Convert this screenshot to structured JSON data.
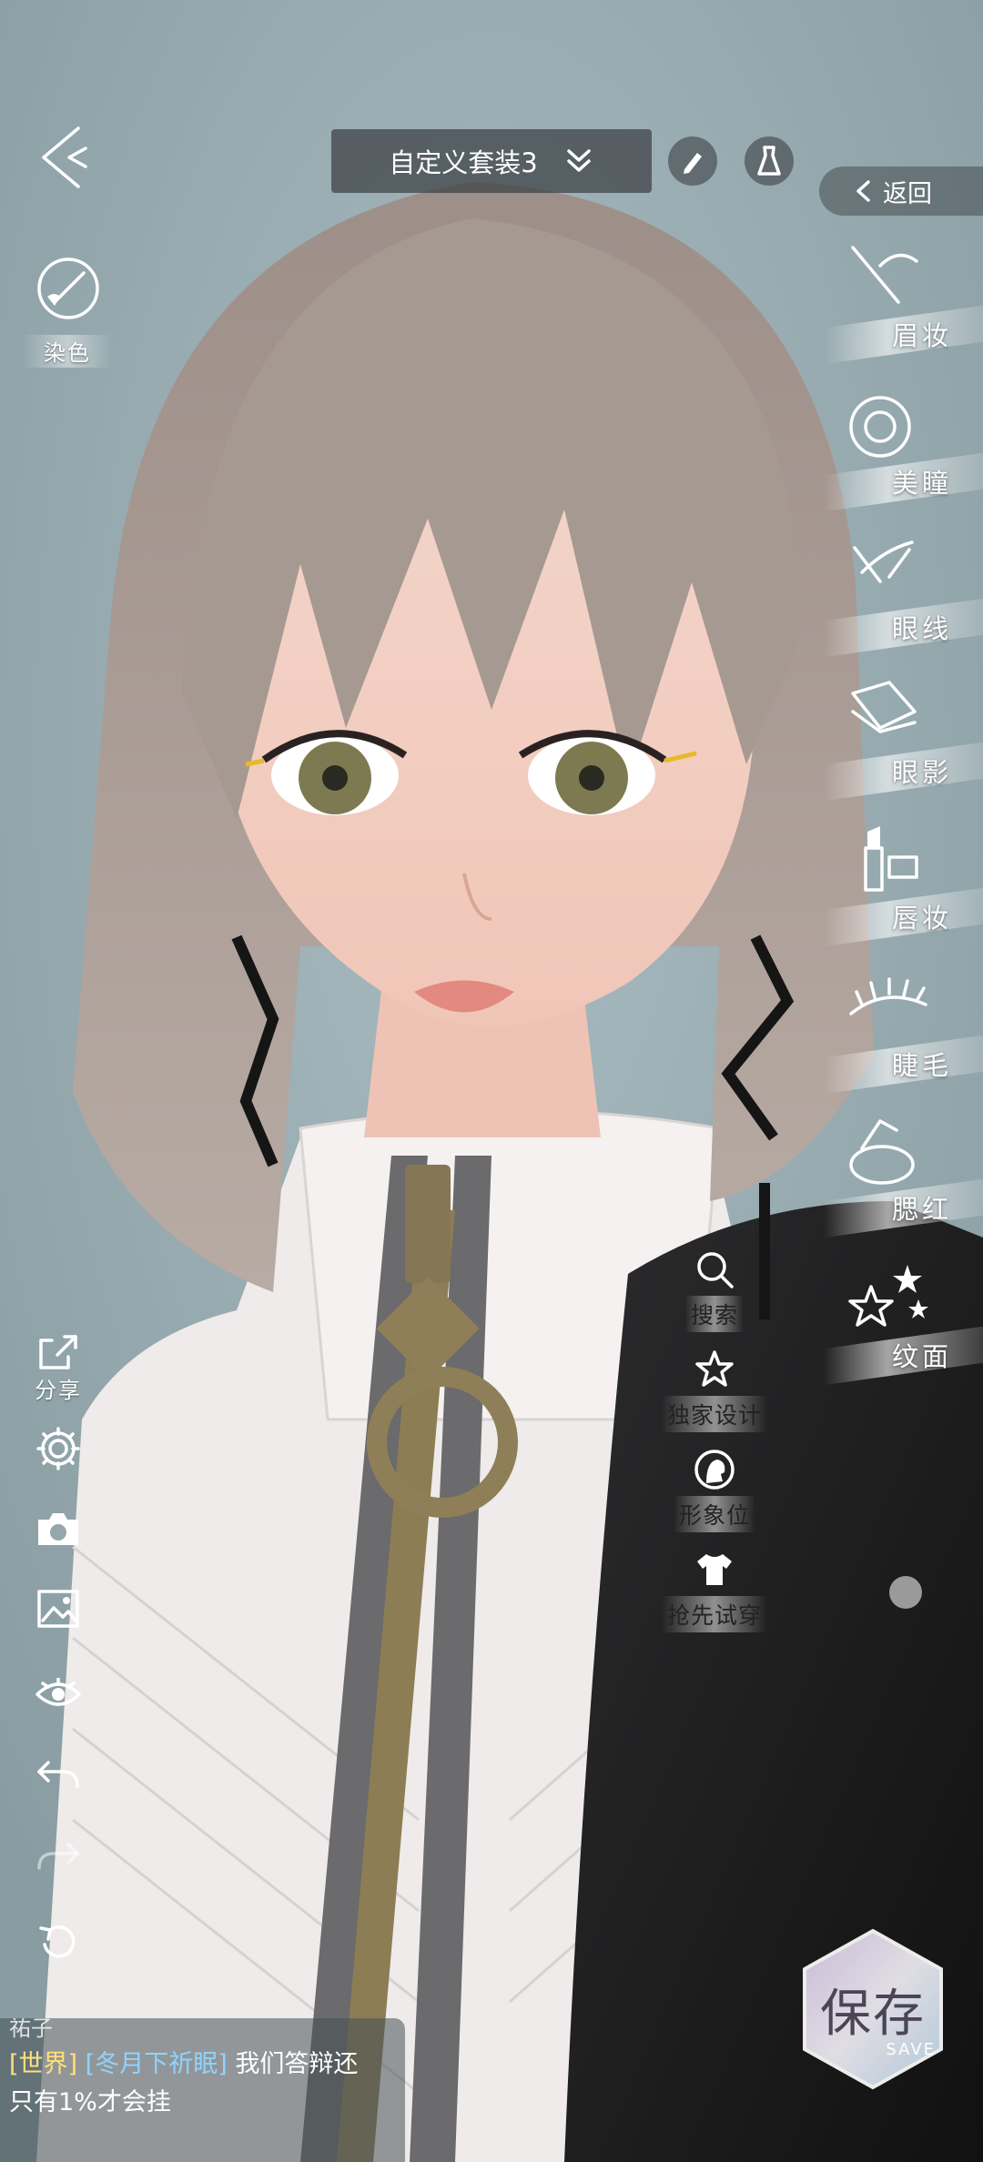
{
  "top_bar": {
    "outfit_name": "自定义套装3",
    "return_label": "返回"
  },
  "left_tools": {
    "dye_label": "染色",
    "share_label": "分享"
  },
  "makeup_menu": [
    {
      "label": "眉妆",
      "icon": "eyebrow-pencil-icon"
    },
    {
      "label": "美瞳",
      "icon": "contact-lens-icon"
    },
    {
      "label": "眼线",
      "icon": "eyeliner-icon"
    },
    {
      "label": "眼影",
      "icon": "eyeshadow-palette-icon"
    },
    {
      "label": "唇妆",
      "icon": "lipstick-icon"
    },
    {
      "label": "睫毛",
      "icon": "eyelash-icon"
    },
    {
      "label": "腮红",
      "icon": "blush-compact-icon"
    },
    {
      "label": "纹面",
      "icon": "stars-tattoo-icon"
    }
  ],
  "quick_actions": [
    {
      "label": "搜索",
      "icon": "search-icon"
    },
    {
      "label": "独家设计",
      "icon": "star-icon"
    },
    {
      "label": "形象位",
      "icon": "avatar-profile-icon"
    },
    {
      "label": "抢先试穿",
      "icon": "tshirt-icon"
    }
  ],
  "chat": {
    "partial_name": "祐子",
    "channel": "[世界]",
    "sender": "[冬月下祈眠]",
    "message_1": "我们答辩还",
    "message_2": "只有1%才会挂"
  },
  "save_button": {
    "label": "保存",
    "sublabel": "SAVE"
  },
  "colors": {
    "background": "#94a7ad",
    "chat_channel": "#ffe07a",
    "chat_sender": "#8fd3ff"
  }
}
